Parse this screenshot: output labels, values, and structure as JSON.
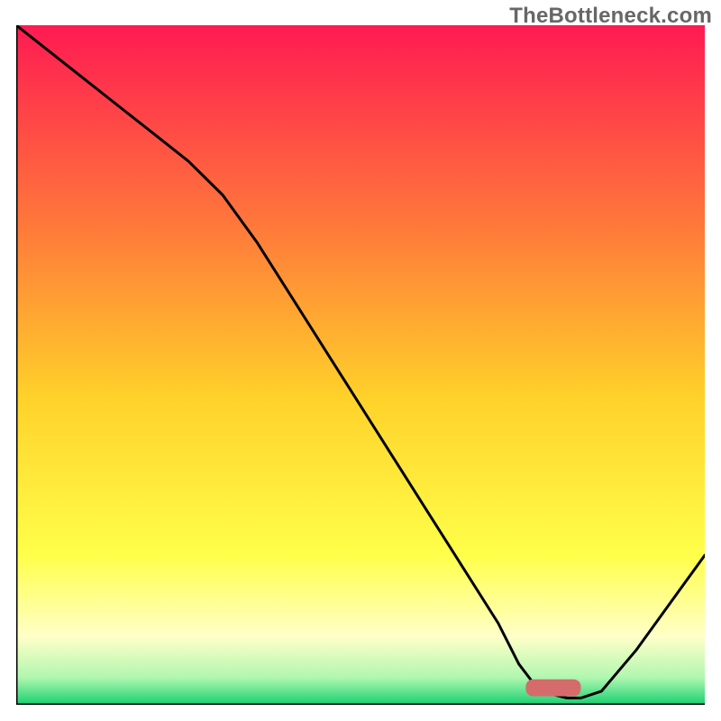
{
  "watermark": "TheBottleneck.com",
  "colors": {
    "gradient_top": "#ff1a52",
    "gradient_mid_orange": "#ff9a2a",
    "gradient_yellow": "#ffe72a",
    "gradient_lightyellow": "#ffffa8",
    "gradient_green": "#26e07a",
    "marker_fill": "#d66b6b",
    "curve": "#000000",
    "axis": "#000000"
  },
  "chart_data": {
    "type": "line",
    "title": "",
    "xlabel": "",
    "ylabel": "",
    "xlim": [
      0,
      100
    ],
    "ylim": [
      0,
      100
    ],
    "grid": false,
    "legend": false,
    "series": [
      {
        "name": "bottleneck-curve",
        "x": [
          0,
          5,
          10,
          15,
          20,
          25,
          30,
          35,
          40,
          45,
          50,
          55,
          60,
          65,
          70,
          73,
          76,
          80,
          82,
          85,
          90,
          95,
          100
        ],
        "y": [
          100,
          96,
          92,
          88,
          84,
          80,
          75,
          68,
          60,
          52,
          44,
          36,
          28,
          20,
          12,
          6,
          2,
          1,
          1,
          2,
          8,
          15,
          22
        ]
      }
    ],
    "annotations": [
      {
        "name": "optimal-marker",
        "shape": "rounded-rect",
        "x_center": 78,
        "y_center": 2.5,
        "width_x": 8,
        "height_y": 2.5,
        "fill_color": "#d66b6b"
      }
    ],
    "background_gradient_stops": [
      {
        "offset": 0.0,
        "color": "#ff1a52"
      },
      {
        "offset": 0.3,
        "color": "#ff7a3a"
      },
      {
        "offset": 0.55,
        "color": "#ffd22a"
      },
      {
        "offset": 0.78,
        "color": "#ffff4a"
      },
      {
        "offset": 0.9,
        "color": "#ffffc8"
      },
      {
        "offset": 0.96,
        "color": "#b0f7b0"
      },
      {
        "offset": 1.0,
        "color": "#18d070"
      }
    ]
  }
}
